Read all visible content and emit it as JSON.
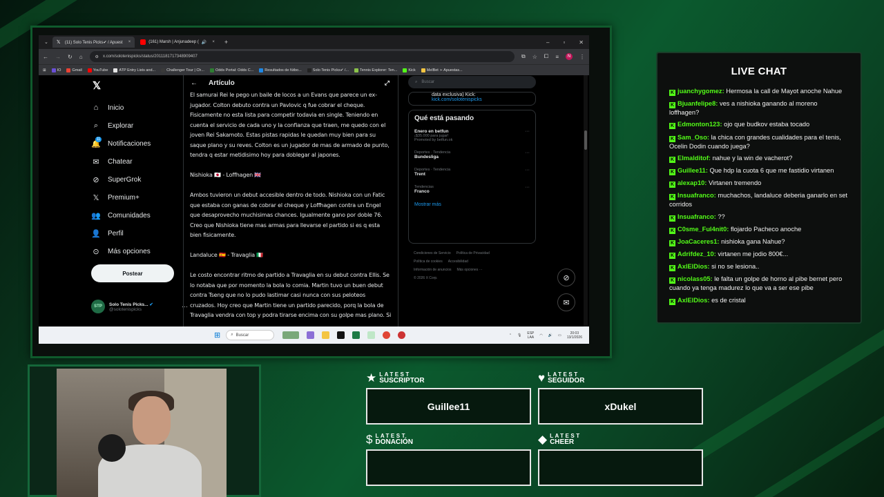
{
  "browser": {
    "tabs": [
      {
        "label": "(11) Solo Tenis Picks✔ / Apuest",
        "icon": "x-logo-icon"
      },
      {
        "label": "(161) Marsh | Anjunadeep (",
        "icon": "youtube-icon"
      }
    ],
    "url": "x.com/solotenispicks/status/2011181717348909407",
    "bookmarks": [
      "IO",
      "Gmail",
      "YouTube",
      "ATP Entry Lists and...",
      "Challenger Tour | Ch...",
      "Odds Portal: Odds C...",
      "Resultados de fútbo...",
      "Solo Tenis Picks✔ /...",
      "Tennis Explorer: Ten...",
      "Kick",
      "MelBet ➢ Apuestas..."
    ]
  },
  "x": {
    "nav": [
      {
        "label": "Inicio",
        "icon": "home-icon",
        "glyph": "⌂"
      },
      {
        "label": "Explorar",
        "icon": "search-icon",
        "glyph": "⌕"
      },
      {
        "label": "Notificaciones",
        "icon": "bell-icon",
        "glyph": "🔔"
      },
      {
        "label": "Chatear",
        "icon": "mail-icon",
        "glyph": "✉"
      },
      {
        "label": "SuperGrok",
        "icon": "grok-icon",
        "glyph": "⊘"
      },
      {
        "label": "Premium+",
        "icon": "x-premium-icon",
        "glyph": "𝕏"
      },
      {
        "label": "Comunidades",
        "icon": "people-icon",
        "glyph": "👥"
      },
      {
        "label": "Perfil",
        "icon": "person-icon",
        "glyph": "👤"
      },
      {
        "label": "Más opciones",
        "icon": "more-circle-icon",
        "glyph": "⊙"
      }
    ],
    "notifications_badge": "11",
    "post_label": "Postear",
    "account": {
      "name": "Solo Tenis Picks...",
      "handle": "@solotenispicks",
      "avatar_text": "STP"
    },
    "article": {
      "header": "Artículo",
      "paragraphs": [
        "El samurai Rei le pego un baile de locos a un Evans que parece un ex-jugador. Colton debuto contra un Pavlovic q fue cobrar el cheque. Fisicamente no esta lista para competir todavia en single. Teniendo en cuenta el servicio de cada uno y la confianza que traen, me quedo con el joven Rei Sakamoto. Estas pistas rapidas le quedan muy bien para su saque plano y su reves. Colton es un jugador de mas de armado de punto, tendra q estar metidisimo hoy para doblegar al japones.",
        "Nishioka 🇯🇵 - Loffhagen 🇬🇧",
        "Ambos tuvieron un debut accesible dentro de todo. Nishioka con un Fatic que estaba con ganas de cobrar el cheque y Loffhagen contra un Engel que desaprovecho muchisimas chances. Igualmente gano por doble 76. Creo que Nishioka tiene mas armas para llevarse el partido si es q esta bien fisicamente.",
        "Landaluce 🇪🇸 - Travaglia 🇮🇹",
        "Le costo encontrar ritmo de partido a Travaglia en su debut contra Ellis. Se lo notaba que por momento la bola lo comia. Martin tuvo un buen debut contra Tseng que no lo pudo lastimar casi nunca con sus peloteos cruzados. Hoy creo que Martin tiene un partido parecido, porq la bola de Travaglia vendra con top y podra tirarse encima con su golpe mas plano. Si"
      ]
    },
    "search_placeholder": "Buscar",
    "promo": {
      "line1": "data exclusiva) Kick:",
      "link": "kick.com/solotenispicks"
    },
    "trends_title": "Qué está pasando",
    "trends": [
      {
        "meta": "¡$35.000 para jugar!",
        "name": "Enero en betfun",
        "extra": "Promoted by betfun.ok"
      },
      {
        "meta": "Deportes · Tendencia",
        "name": "Bundesliga",
        "extra": ""
      },
      {
        "meta": "Deportes · Tendencia",
        "name": "Trent",
        "extra": ""
      },
      {
        "meta": "Tendencias",
        "name": "Franco",
        "extra": ""
      }
    ],
    "show_more": "Mostrar más",
    "footer": [
      "Condiciones de Servicio",
      "Política de Privacidad",
      "Política de cookies",
      "Accesibilidad",
      "Información de anuncios",
      "Más opciones ···",
      "© 2026 X Corp."
    ]
  },
  "taskbar": {
    "search": "Buscar",
    "lang": "ESP\nLAA",
    "time": "20:03",
    "date": "13/1/2026"
  },
  "chat": {
    "title": "LIVE CHAT",
    "messages": [
      {
        "user": "juanchygomez:",
        "text": "Hermosa la call de Mayot anoche Nahue"
      },
      {
        "user": "Bjuanfelipe8:",
        "text": "ves a nishioka ganando al moreno loffhagen?"
      },
      {
        "user": "Edmonton123:",
        "text": "ojo que budkov estaba tocado"
      },
      {
        "user": "Sam_Oso:",
        "text": "la chica con grandes cualidades para el tenis, Ocelin Dodin cuando juega?"
      },
      {
        "user": "Elmalditof:",
        "text": "nahue y la win de vacherot?"
      },
      {
        "user": "Guillee11:",
        "text": "Que hdp la cuota 6 que me fastidio virtanen"
      },
      {
        "user": "alexap10:",
        "text": "Virtanen tremendo"
      },
      {
        "user": "Insuafranco:",
        "text": "muchachos, landaluce deberia ganarlo en set corridos"
      },
      {
        "user": "Insuafranco:",
        "text": "??"
      },
      {
        "user": "C0sme_Ful4nit0:",
        "text": "flojardo Pacheco anoche"
      },
      {
        "user": "JoaCaceres1:",
        "text": "nishioka gana Nahue?"
      },
      {
        "user": "Adrifdez_10:",
        "text": "virtanen me jodio 800€..."
      },
      {
        "user": "AxlElDios:",
        "text": "si no se lesiona.."
      },
      {
        "user": "nicolass05:",
        "text": "le falta un golpe de horno al pibe bernet pero cuando ya tenga madurez lo que va a ser ese pibe"
      },
      {
        "user": "AxlElDios:",
        "text": "es de cristal"
      }
    ]
  },
  "alerts": [
    {
      "latest": "LATEST",
      "kind": "SUSCRIPTOR",
      "icon": "star-icon",
      "glyph": "★",
      "value": "Guillee11"
    },
    {
      "latest": "LATEST",
      "kind": "SEGUIDOR",
      "icon": "heart-icon",
      "glyph": "♥",
      "value": "xDukel"
    },
    {
      "latest": "LATEST",
      "kind": "DONACIÓN",
      "icon": "dollar-icon",
      "glyph": "$",
      "value": ""
    },
    {
      "latest": "LATEST",
      "kind": "CHEER",
      "icon": "diamond-icon",
      "glyph": "◆",
      "value": ""
    }
  ],
  "colors": {
    "accent_green": "#53fc18",
    "x_blue": "#1d9bf0",
    "frame_green": "#15673a"
  }
}
